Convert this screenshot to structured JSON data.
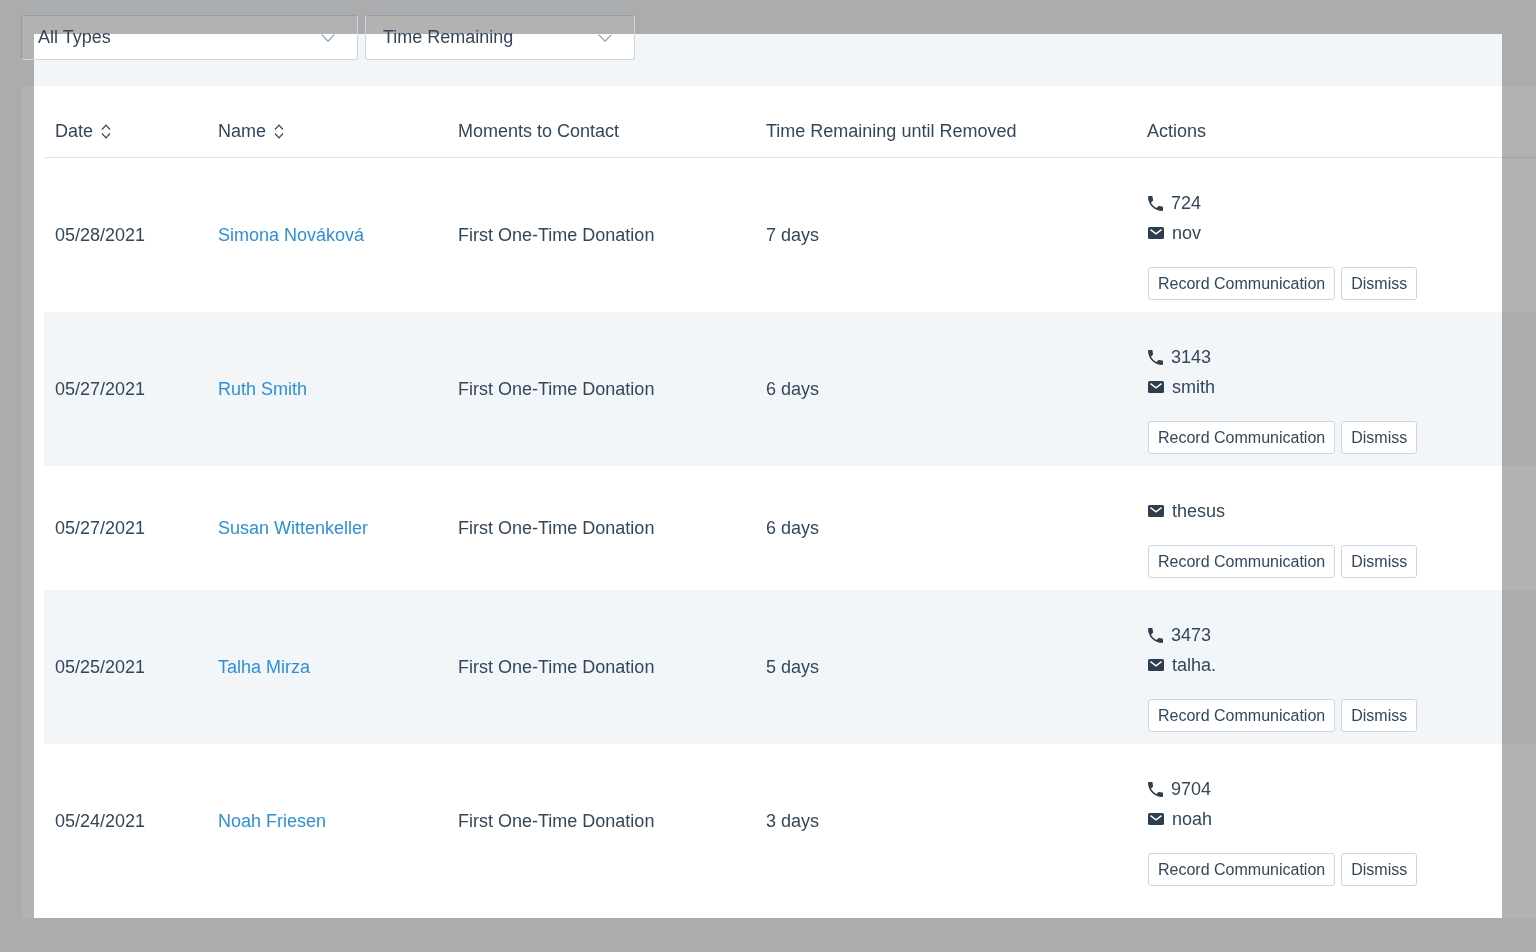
{
  "filters": [
    {
      "value": "All Types"
    },
    {
      "value": "Time Remaining"
    }
  ],
  "table": {
    "columns": [
      {
        "label": "Date",
        "sortable": true
      },
      {
        "label": "Name",
        "sortable": true
      },
      {
        "label": "Moments to Contact",
        "sortable": false
      },
      {
        "label": "Time Remaining until Removed",
        "sortable": false
      },
      {
        "label": "Actions",
        "sortable": false
      }
    ],
    "rows": [
      {
        "date": "05/28/2021",
        "name": "Simona Nováková",
        "moment": "First One-Time Donation",
        "time_remaining": "7 days",
        "contacts": [
          {
            "kind": "phone",
            "value": "724"
          },
          {
            "kind": "email",
            "value": "nov"
          }
        ],
        "actions": [
          "Record Communication",
          "Dismiss"
        ]
      },
      {
        "date": "05/27/2021",
        "name": "Ruth Smith",
        "moment": "First One-Time Donation",
        "time_remaining": "6 days",
        "contacts": [
          {
            "kind": "phone",
            "value": "3143"
          },
          {
            "kind": "email",
            "value": "smith"
          }
        ],
        "actions": [
          "Record Communication",
          "Dismiss"
        ]
      },
      {
        "date": "05/27/2021",
        "name": "Susan Wittenkeller",
        "moment": "First One-Time Donation",
        "time_remaining": "6 days",
        "contacts": [
          {
            "kind": "email",
            "value": "thesus"
          }
        ],
        "actions": [
          "Record Communication",
          "Dismiss"
        ]
      },
      {
        "date": "05/25/2021",
        "name": "Talha Mirza",
        "moment": "First One-Time Donation",
        "time_remaining": "5 days",
        "contacts": [
          {
            "kind": "phone",
            "value": "3473"
          },
          {
            "kind": "email",
            "value": "talha."
          }
        ],
        "actions": [
          "Record Communication",
          "Dismiss"
        ]
      },
      {
        "date": "05/24/2021",
        "name": "Noah Friesen",
        "moment": "First One-Time Donation",
        "time_remaining": "3 days",
        "contacts": [
          {
            "kind": "phone",
            "value": "9704"
          },
          {
            "kind": "email",
            "value": "noah"
          }
        ],
        "actions": [
          "Record Communication",
          "Dismiss"
        ]
      }
    ]
  }
}
